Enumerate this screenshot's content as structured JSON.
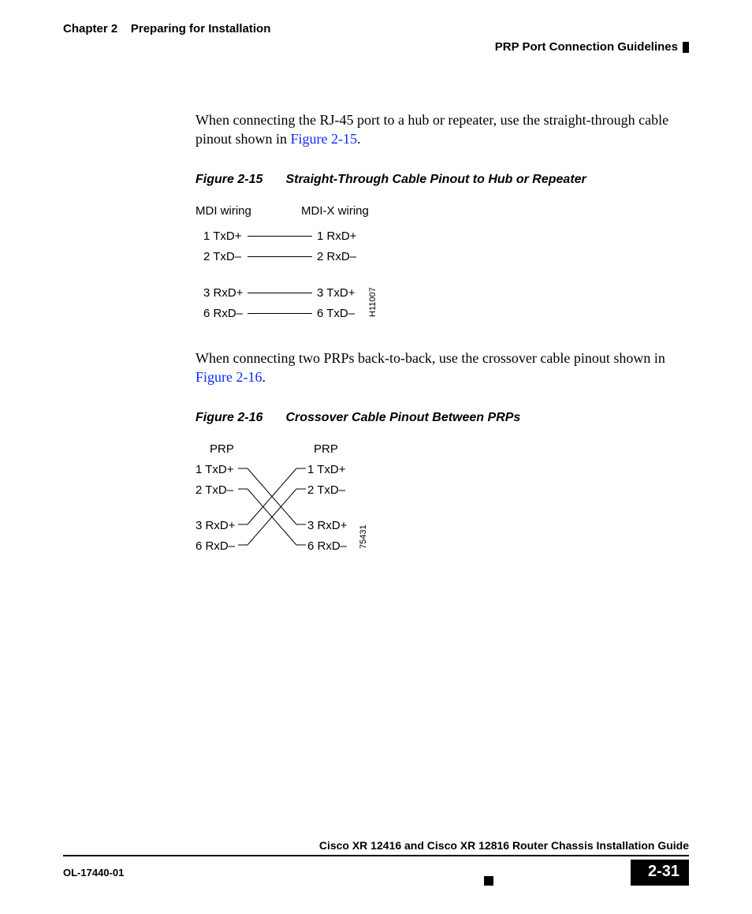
{
  "header": {
    "chapter_label": "Chapter 2",
    "chapter_title": "Preparing for Installation",
    "section_title": "PRP Port Connection Guidelines"
  },
  "para1_a": "When connecting the RJ-45 port to a hub or repeater, use the straight-through cable pinout shown in ",
  "para1_link": "Figure 2-15",
  "para1_b": ".",
  "fig15": {
    "num": "Figure 2-15",
    "title": "Straight-Through Cable Pinout to Hub or Repeater",
    "left_head": "MDI wiring",
    "right_head": "MDI-X wiring",
    "left": [
      "1 TxD+",
      "2 TxD–",
      "3 RxD+",
      "6 RxD–"
    ],
    "right": [
      "1 RxD+",
      "2 RxD–",
      "3 TxD+",
      "6 TxD–"
    ],
    "id": "H11007"
  },
  "para2_a": "When connecting two PRPs back-to-back, use the crossover cable pinout shown in ",
  "para2_link": "Figure 2-16",
  "para2_b": ".",
  "fig16": {
    "num": "Figure 2-16",
    "title": "Crossover Cable Pinout Between PRPs",
    "left_head": "PRP",
    "right_head": "PRP",
    "left": [
      "1 TxD+",
      "2 TxD–",
      "3 RxD+",
      "6 RxD–"
    ],
    "right": [
      "1 TxD+",
      "2 TxD–",
      "3 RxD+",
      "6 RxD–"
    ],
    "id": "75431"
  },
  "footer": {
    "guide_title": "Cisco XR 12416 and Cisco XR 12816 Router Chassis Installation Guide",
    "doc_id": "OL-17440-01",
    "page": "2-31"
  }
}
